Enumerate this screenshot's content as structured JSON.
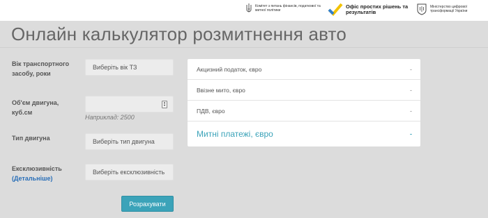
{
  "header": {
    "logo1_text": "Комітет з питань фінансів, податкової та митної політики",
    "logo2_text": "Офіс простих рішень та результатів",
    "logo3_text": "Міністерство цифрової трансформації України"
  },
  "page_title": "Онлайн калькулятор розмитнення авто",
  "form": {
    "age_label": "Вік транспортного засобу, роки",
    "age_placeholder": "Виберіть вік ТЗ",
    "volume_label": "Об'єм двигуна, куб.см",
    "volume_value": "",
    "volume_hint": "Наприклад: 2500",
    "engine_label": "Тип двигуна",
    "engine_placeholder": "Виберіть тип двигуна",
    "exclusive_label": "Ексклюзивність",
    "exclusive_link": "(Детальніше)",
    "exclusive_placeholder": "Виберіть ексклюзивність",
    "calc_button": "Розрахувати"
  },
  "results": [
    {
      "label": "Акцизний податок, євро",
      "value": "-"
    },
    {
      "label": "Ввізне мито, євро",
      "value": "-"
    },
    {
      "label": "ПДВ, євро",
      "value": "-"
    },
    {
      "label": "Митні платежі, євро",
      "value": "-"
    }
  ],
  "colors": {
    "accent": "#3ba3b9",
    "background": "#dcdcdc",
    "link": "#2a6fb8"
  }
}
